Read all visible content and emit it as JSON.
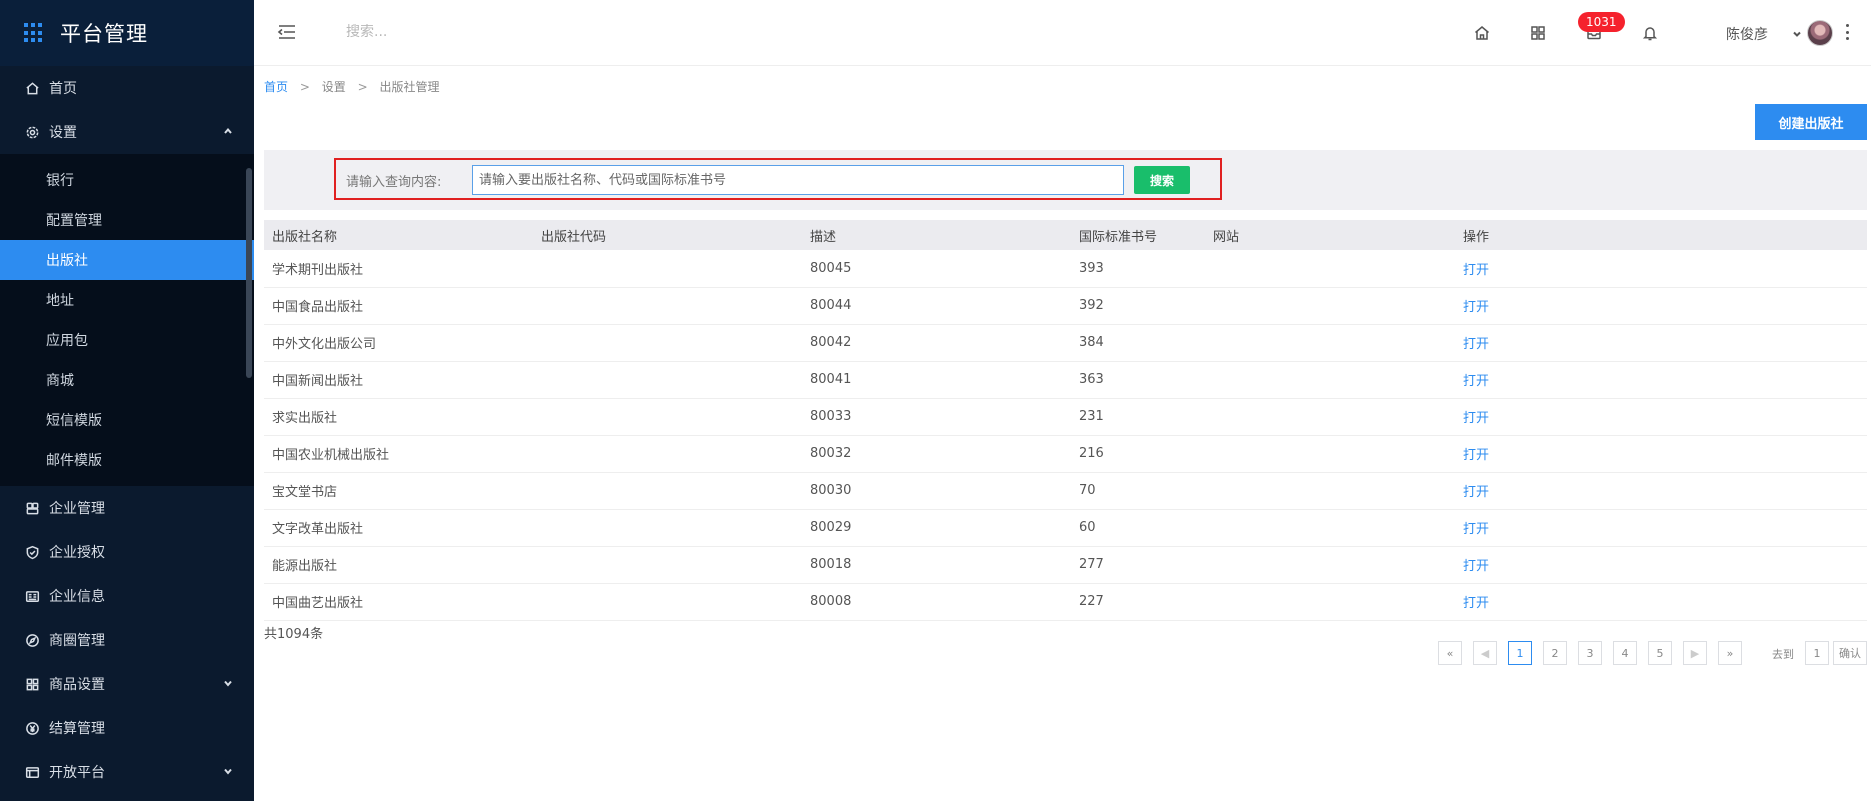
{
  "sidebar": {
    "title": "平台管理",
    "items": [
      {
        "label": "首页",
        "icon": "home-icon"
      },
      {
        "label": "设置",
        "icon": "gear-icon",
        "expanded": true
      },
      {
        "label": "企业管理",
        "icon": "building-icon"
      },
      {
        "label": "企业授权",
        "icon": "shield-icon"
      },
      {
        "label": "企业信息",
        "icon": "id-card-icon"
      },
      {
        "label": "商圈管理",
        "icon": "compass-icon"
      },
      {
        "label": "商品设置",
        "icon": "grid-icon"
      },
      {
        "label": "结算管理",
        "icon": "yen-icon"
      },
      {
        "label": "开放平台",
        "icon": "panel-icon"
      }
    ],
    "sub_items": [
      "银行",
      "配置管理",
      "出版社",
      "地址",
      "应用包",
      "商城",
      "短信模版",
      "邮件模版"
    ],
    "active_sub": "出版社"
  },
  "header": {
    "search_placeholder": "搜索...",
    "badge_count": "1031",
    "username": "陈俊彦",
    "icons": [
      "menu-toggle-icon",
      "home-icon",
      "apps-icon",
      "inbox-icon",
      "bell-icon",
      "more-icon"
    ]
  },
  "breadcrumb": {
    "home": "首页",
    "sep1": ">",
    "level2": "设置",
    "sep2": ">",
    "current": "出版社管理"
  },
  "create_button": "创建出版社",
  "filter": {
    "label": "请输入查询内容:",
    "placeholder": "请输入要出版社名称、代码或国际标准书号",
    "search_button": "搜索"
  },
  "table": {
    "headers": {
      "name": "出版社名称",
      "code": "出版社代码",
      "desc": "描述",
      "isbn": "国际标准书号",
      "website": "网站",
      "op": "操作"
    },
    "rows": [
      {
        "name": "学术期刊出版社",
        "code": "",
        "desc": "80045",
        "isbn": "393",
        "website": "",
        "op": "打开"
      },
      {
        "name": "中国食品出版社",
        "code": "",
        "desc": "80044",
        "isbn": "392",
        "website": "",
        "op": "打开"
      },
      {
        "name": "中外文化出版公司",
        "code": "",
        "desc": "80042",
        "isbn": "384",
        "website": "",
        "op": "打开"
      },
      {
        "name": "中国新闻出版社",
        "code": "",
        "desc": "80041",
        "isbn": "363",
        "website": "",
        "op": "打开"
      },
      {
        "name": "求实出版社",
        "code": "",
        "desc": "80033",
        "isbn": "231",
        "website": "",
        "op": "打开"
      },
      {
        "name": "中国农业机械出版社",
        "code": "",
        "desc": "80032",
        "isbn": "216",
        "website": "",
        "op": "打开"
      },
      {
        "name": "宝文堂书店",
        "code": "",
        "desc": "80030",
        "isbn": "70",
        "website": "",
        "op": "打开"
      },
      {
        "name": "文字改革出版社",
        "code": "",
        "desc": "80029",
        "isbn": "60",
        "website": "",
        "op": "打开"
      },
      {
        "name": "能源出版社",
        "code": "",
        "desc": "80018",
        "isbn": "277",
        "website": "",
        "op": "打开"
      },
      {
        "name": "中国曲艺出版社",
        "code": "",
        "desc": "80008",
        "isbn": "227",
        "website": "",
        "op": "打开"
      }
    ]
  },
  "total": "共1094条",
  "pagination": {
    "first": "«",
    "prev": "◀",
    "pages": [
      "1",
      "2",
      "3",
      "4",
      "5"
    ],
    "current": "1",
    "next": "▶",
    "last": "»",
    "goto_label": "去到",
    "goto_value": "1",
    "confirm": "确认"
  }
}
